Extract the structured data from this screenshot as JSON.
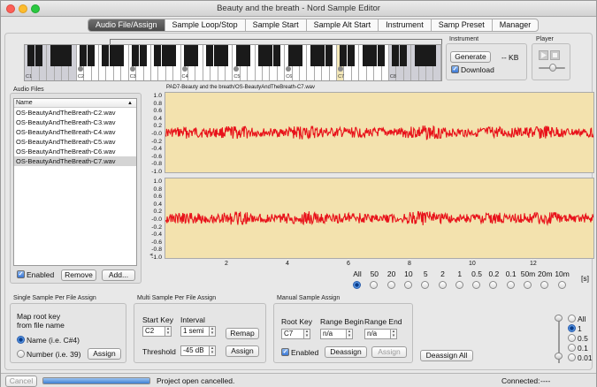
{
  "window": {
    "title": "Beauty and the breath - Nord Sample Editor"
  },
  "tabs": [
    "Audio File/Assign",
    "Sample Loop/Stop",
    "Sample Start",
    "Sample Alt Start",
    "Instrument",
    "Samp Preset",
    "Manager"
  ],
  "keyboard": {
    "labels": [
      "C1",
      "C2",
      "C3",
      "C4",
      "C5",
      "C6",
      "C7",
      "C8"
    ]
  },
  "instrument": {
    "title": "Instrument",
    "generate_label": "Generate",
    "size_text": "-- KB",
    "download_label": "Download",
    "download_checked": true
  },
  "player": {
    "title": "Player",
    "play_icon": "play-icon",
    "stop_icon": "stop-icon"
  },
  "audio_files": {
    "title": "Audio Files",
    "column": "Name",
    "files": [
      "OS-BeautyAndTheBreath-C2.wav",
      "OS-BeautyAndTheBreath-C3.wav",
      "OS-BeautyAndTheBreath-C4.wav",
      "OS-BeautyAndTheBreath-C5.wav",
      "OS-BeautyAndTheBreath-C6.wav",
      "OS-BeautyAndTheBreath-C7.wav"
    ],
    "selected_index": 5,
    "enabled_label": "Enabled",
    "enabled_checked": true,
    "remove_label": "Remove",
    "add_label": "Add..."
  },
  "waveform": {
    "path": "PAD7-Beauty and the breath/OS-BeautyAndTheBreath-C7.wav",
    "y_ticks": [
      "1.0",
      "0.8",
      "0.6",
      "0.4",
      "0.2",
      "-0.0",
      "-0.2",
      "-0.4",
      "-0.6",
      "-0.8",
      "-1.0"
    ],
    "x_ticks": [
      "2",
      "4",
      "6",
      "8",
      "10",
      "12"
    ],
    "wave_color": "#e8121a",
    "background_color": "#f3e2ae"
  },
  "time_scale": {
    "options": [
      "All",
      "50",
      "20",
      "10",
      "5",
      "2",
      "1",
      "0.5",
      "0.2",
      "0.1",
      "50m",
      "20m",
      "10m"
    ],
    "selected_index": 0,
    "unit": "[s]"
  },
  "single_assign": {
    "title": "Single Sample Per File Assign",
    "map_text": "Map root key",
    "from_text": "from file name",
    "name_option": "Name (i.e. C#4)",
    "number_option": "Number (i.e. 39)",
    "selected": "name",
    "assign_label": "Assign"
  },
  "multi_assign": {
    "title": "Multi Sample Per File Assign",
    "start_key_label": "Start Key",
    "start_key_value": "C2",
    "interval_label": "Interval",
    "interval_value": "1 semi",
    "remap_label": "Remap",
    "threshold_label": "Threshold",
    "threshold_value": "-45 dB",
    "assign_label": "Assign"
  },
  "manual_assign": {
    "title": "Manual Sample Assign",
    "root_key_label": "Root Key",
    "root_key_value": "C7",
    "range_begin_label": "Range Begin",
    "range_begin_value": "n/a",
    "range_end_label": "Range End",
    "range_end_value": "n/a",
    "enabled_label": "Enabled",
    "enabled_checked": true,
    "deassign_label": "Deassign",
    "assign_label": "Assign",
    "deassign_all_label": "Deassign All"
  },
  "amplitude_scale": {
    "options": [
      "All",
      "1",
      "0.5",
      "0.1",
      "0.01"
    ],
    "selected_index": 1
  },
  "status": {
    "cancel_label": "Cancel",
    "message": "Project open cancelled.",
    "progress": 1.0,
    "connected_label": "Connected:",
    "connected_value": "----"
  }
}
